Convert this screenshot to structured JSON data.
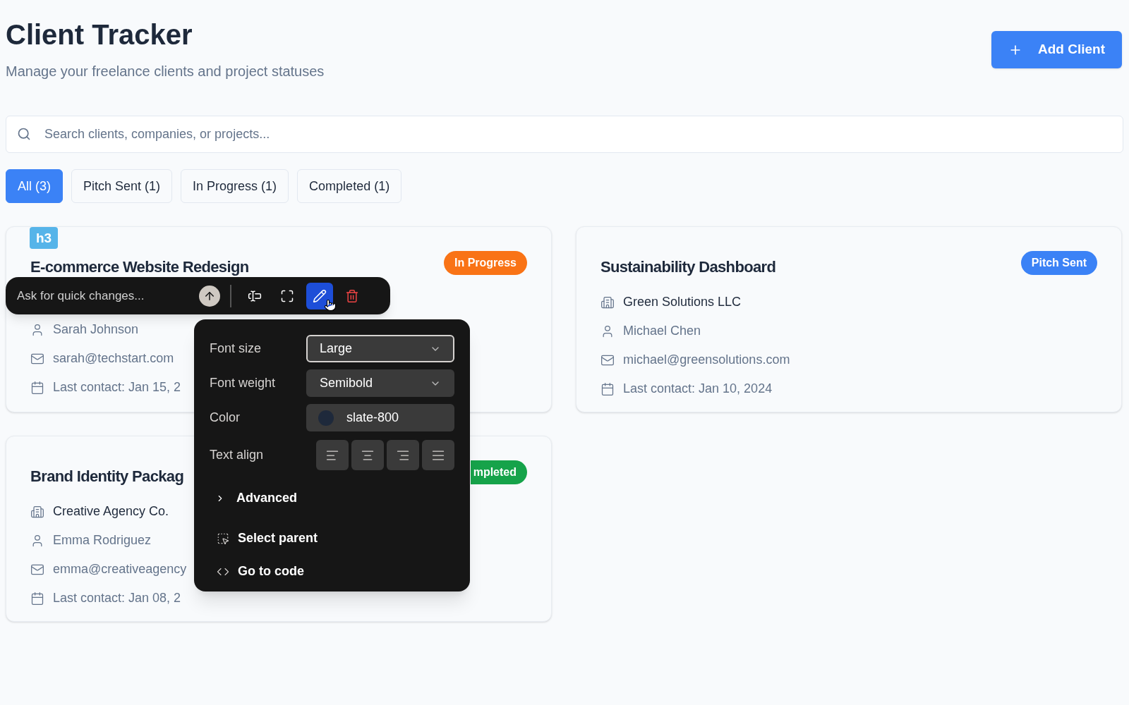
{
  "header": {
    "title": "Client Tracker",
    "subtitle": "Manage your freelance clients and project statuses",
    "add_button": "Add Client"
  },
  "search": {
    "placeholder": "Search clients, companies, or projects..."
  },
  "filters": [
    {
      "label": "All (3)",
      "selected": true
    },
    {
      "label": "Pitch Sent (1)",
      "selected": false
    },
    {
      "label": "In Progress (1)",
      "selected": false
    },
    {
      "label": "Completed (1)",
      "selected": false
    }
  ],
  "cards": [
    {
      "title": "E-commerce Website Redesign",
      "status": {
        "label": "In Progress",
        "color": "#f97316"
      },
      "contact": "Sarah Johnson",
      "email": "sarah@techstart.com",
      "last_contact": "Last contact: Jan 15, 2"
    },
    {
      "title": "Sustainability Dashboard",
      "status": {
        "label": "Pitch Sent",
        "color": "#3b82f6"
      },
      "company": "Green Solutions LLC",
      "contact": "Michael Chen",
      "email": "michael@greensolutions.com",
      "last_contact": "Last contact: Jan 10, 2024"
    },
    {
      "title": "Brand Identity Packag",
      "status": {
        "label": "mpleted",
        "color": "#16a34a"
      },
      "company": "Creative Agency Co.",
      "contact": "Emma Rodriguez",
      "email": "emma@creativeagency",
      "last_contact": "Last contact: Jan 08, 2"
    }
  ],
  "editor": {
    "element_tag": "h3",
    "prompt_placeholder": "Ask for quick changes...",
    "tools": [
      {
        "kind": "text-select",
        "selected": false
      },
      {
        "kind": "expand",
        "selected": false
      },
      {
        "kind": "edit",
        "selected": true
      },
      {
        "kind": "delete",
        "selected": false
      }
    ],
    "panel": {
      "fields": [
        {
          "label": "Font size",
          "value": "Large",
          "kind": "select",
          "focused": true
        },
        {
          "label": "Font weight",
          "value": "Semibold",
          "kind": "select",
          "focused": false
        },
        {
          "label": "Color",
          "value": "slate-800",
          "kind": "color",
          "color": "#1e293b"
        }
      ],
      "text_align": {
        "label": "Text align",
        "options": [
          {
            "kind": "left",
            "selected": false
          },
          {
            "kind": "center",
            "selected": false
          },
          {
            "kind": "right",
            "selected": false
          },
          {
            "kind": "justify",
            "selected": false
          }
        ]
      },
      "advanced": {
        "label": "Advanced",
        "expanded": false
      },
      "actions": [
        {
          "kind": "select-parent",
          "label": "Select parent"
        },
        {
          "kind": "code",
          "label": "Go to code"
        }
      ]
    }
  }
}
